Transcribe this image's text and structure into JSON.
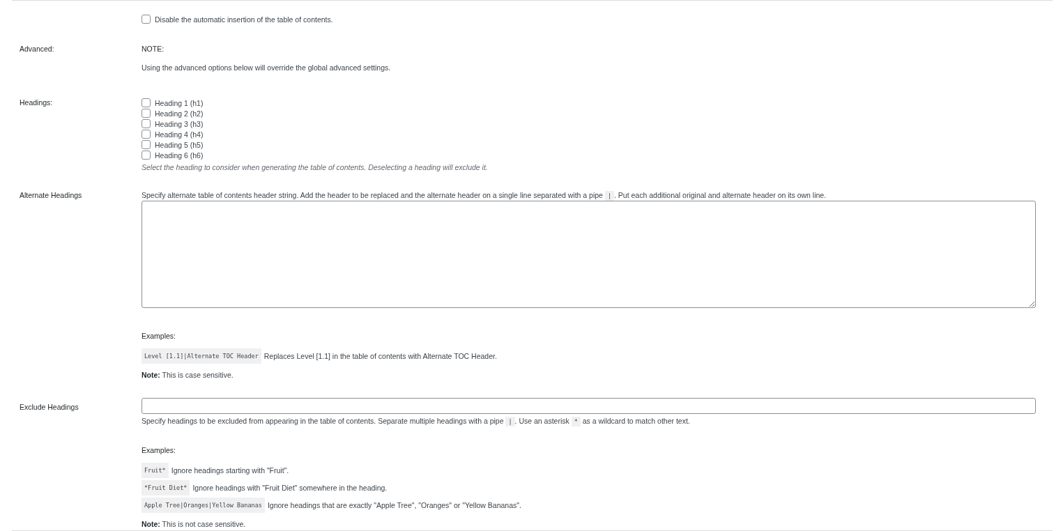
{
  "disable_toc": {
    "label": "Disable the automatic insertion of the table of contents.",
    "checked": false
  },
  "sections": [
    {
      "kind": "note",
      "label": "Advanced:",
      "title": "NOTE:",
      "text": "Using the advanced options below will override the global advanced settings."
    },
    {
      "kind": "checkboxes",
      "label": "Headings:",
      "options": [
        {
          "label": "Heading 1 (h1)",
          "checked": false
        },
        {
          "label": "Heading 2 (h2)",
          "checked": false
        },
        {
          "label": "Heading 3 (h3)",
          "checked": false
        },
        {
          "label": "Heading 4 (h4)",
          "checked": false
        },
        {
          "label": "Heading 5 (h5)",
          "checked": false
        },
        {
          "label": "Heading 6 (h6)",
          "checked": false
        }
      ],
      "hint": "Select the heading to consider when generating the table of contents. Deselecting a heading will exclude it."
    },
    {
      "kind": "textarea",
      "label": "Alternate Headings",
      "description": [
        {
          "kind": "text",
          "text": "Specify alternate table of contents header string. Add the header to be replaced and the alternate header on a single line separated with a pipe "
        },
        {
          "kind": "code",
          "text": "|"
        },
        {
          "kind": "text",
          "text": ". Put each additional original and alternate header on its own line."
        }
      ],
      "examples_title": "Examples:",
      "examples": [
        {
          "code": "Level [1.1]|Alternate TOC Header",
          "text": "Replaces Level [1.1] in the table of contents with Alternate TOC Header."
        }
      ],
      "note": "**Note:** This is case sensitive."
    },
    {
      "kind": "input",
      "label": "Exclude Headings",
      "description": [
        {
          "kind": "text",
          "text": "Specify headings to be excluded from appearing in the table of contents. Separate multiple headings with a pipe "
        },
        {
          "kind": "code",
          "text": "|"
        },
        {
          "kind": "text",
          "text": ". Use an asterisk "
        },
        {
          "kind": "code",
          "text": "*"
        },
        {
          "kind": "text",
          "text": " as a wildcard to match other text."
        }
      ],
      "examples_title": "Examples:",
      "examples": [
        {
          "code": "Fruit*",
          "text": "Ignore headings starting with \"Fruit\"."
        },
        {
          "code": "*Fruit Diet*",
          "text": "Ignore headings with \"Fruit Diet\" somewhere in the heading."
        },
        {
          "code": "Apple Tree|Oranges|Yellow Bananas",
          "text": "Ignore headings that are exactly \"Apple Tree\", \"Oranges\" or \"Yellow Bananas\"."
        }
      ],
      "note": "**Note:** This is not case sensitive."
    }
  ]
}
